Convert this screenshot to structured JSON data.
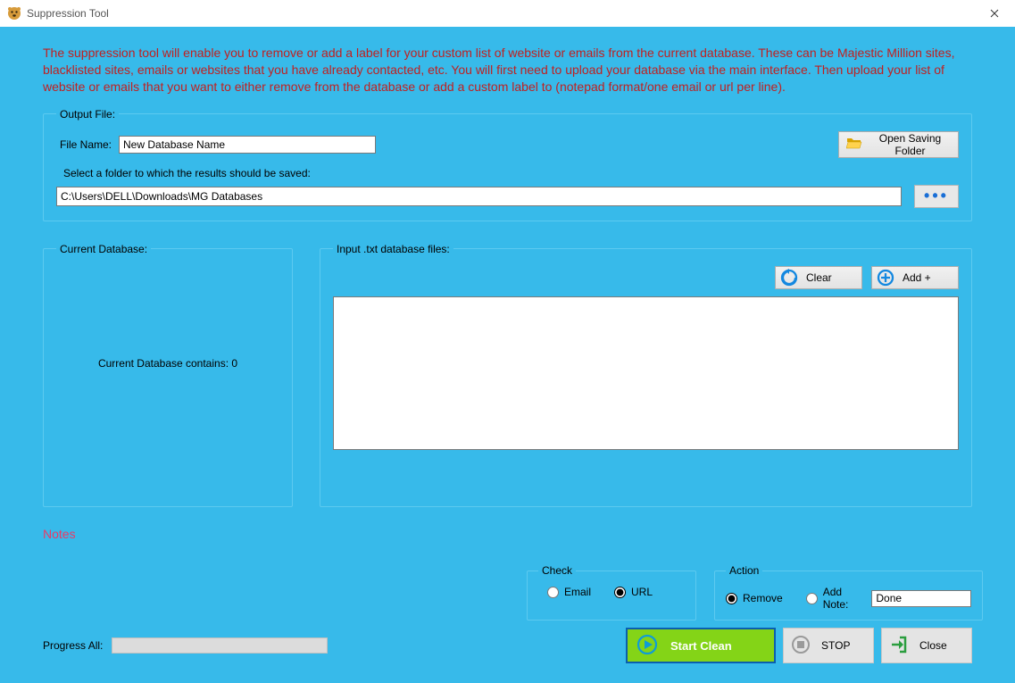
{
  "window": {
    "title": "Suppression Tool"
  },
  "intro": "The suppression tool will enable you to remove or add a label for your custom list of website or emails from the current database. These can be Majestic Million sites, blacklisted sites, emails or websites that you have already contacted, etc. You will first need to upload your database via the main interface. Then upload your list of website or emails that you want to either remove from the database or add a custom label to (notepad format/one email or url per line).",
  "output": {
    "legend": "Output File:",
    "filename_label": "File Name:",
    "filename_value": "New Database Name",
    "open_folder_label": "Open Saving Folder",
    "folder_hint": "Select a folder to which the results should be saved:",
    "folder_value": "C:\\Users\\DELL\\Downloads\\MG Databases"
  },
  "current_db": {
    "legend": "Current Database:",
    "status": "Current Database contains: 0"
  },
  "input_files": {
    "legend": "Input .txt database files:",
    "clear_label": "Clear",
    "add_label": "Add +"
  },
  "notes_label": "Notes",
  "check": {
    "legend": "Check",
    "email_label": "Email",
    "url_label": "URL",
    "selected": "url"
  },
  "action": {
    "legend": "Action",
    "remove_label": "Remove",
    "addnote_label": "Add Note:",
    "selected": "remove",
    "note_value": "Done"
  },
  "progress": {
    "label": "Progress All:"
  },
  "buttons": {
    "start": "Start Clean",
    "stop": "STOP",
    "close": "Close"
  }
}
